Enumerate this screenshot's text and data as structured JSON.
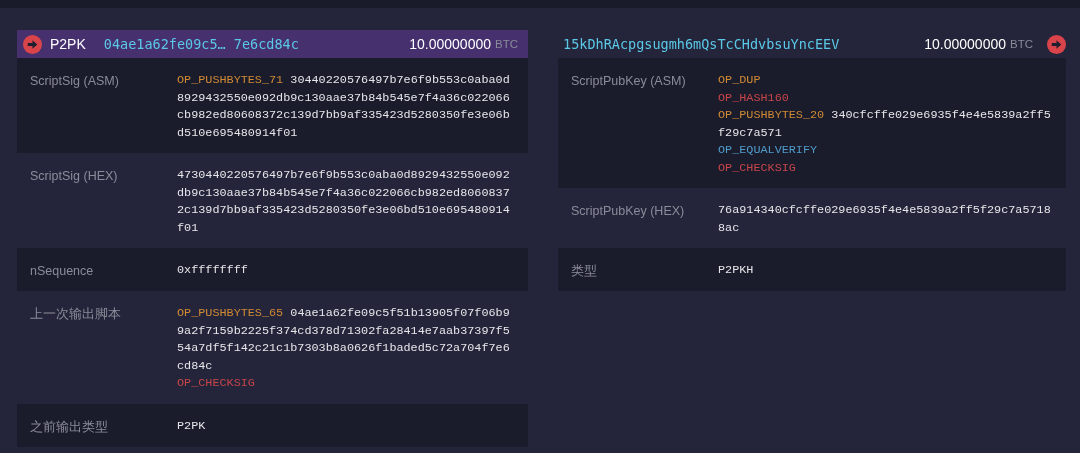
{
  "input": {
    "type": "P2PK",
    "script_preview": "04ae1a62fe09c5… 7e6cd84c",
    "amount": "10.00000000",
    "unit": "BTC",
    "rows": [
      {
        "label": "ScriptSig (ASM)",
        "lines": [
          [
            {
              "text": "OP_PUSHBYTES_71",
              "color": "#d08a34"
            },
            {
              "text": "30440220576497b7e6f9b553c0aba0d8929432550e092db9c130aae37b84b545e7f4a36c022066cb982ed80608372c139d7bb9af335423d5280350fe3e06bd510e695480914f01"
            }
          ]
        ]
      },
      {
        "label": "ScriptSig (HEX)",
        "lines": [
          [
            {
              "text": "4730440220576497b7e6f9b553c0aba0d8929432550e092db9c130aae37b84b545e7f4a36c022066cb982ed80608372c139d7bb9af335423d5280350fe3e06bd510e695480914f01"
            }
          ]
        ]
      },
      {
        "label": "nSequence",
        "lines": [
          [
            {
              "text": "0xffffffff"
            }
          ]
        ]
      },
      {
        "label": "上一次输出脚本",
        "lines": [
          [
            {
              "text": "OP_PUSHBYTES_65",
              "color": "#d08a34"
            },
            {
              "text": "04ae1a62fe09c5f51b13905f07f06b99a2f7159b2225f374cd378d71302fa28414e7aab37397f554a7df5f142c21c1b7303b8a0626f1baded5c72a704f7e6cd84c"
            }
          ],
          [
            {
              "text": "OP_CHECKSIG",
              "color": "#c8454a"
            }
          ]
        ]
      },
      {
        "label": "之前输出类型",
        "lines": [
          [
            {
              "text": "P2PK"
            }
          ]
        ]
      }
    ]
  },
  "output": {
    "address": "15kDhRAcpgsugmh6mQsTcCHdvbsuYncEEV",
    "amount": "10.00000000",
    "unit": "BTC",
    "rows": [
      {
        "label": "ScriptPubKey (ASM)",
        "lines": [
          [
            {
              "text": "OP_DUP",
              "color": "#d08a34"
            }
          ],
          [
            {
              "text": "OP_HASH160",
              "color": "#c8454a"
            }
          ],
          [
            {
              "text": "OP_PUSHBYTES_20",
              "color": "#d08a34"
            },
            {
              "text": "340cfcffe029e6935f4e4e5839a2ff5f29c7a571"
            }
          ],
          [
            {
              "text": "OP_EQUALVERIFY",
              "color": "#4f9bc9"
            }
          ],
          [
            {
              "text": "OP_CHECKSIG",
              "color": "#c8454a"
            }
          ]
        ]
      },
      {
        "label": "ScriptPubKey (HEX)",
        "lines": [
          [
            {
              "text": "76a914340cfcffe029e6935f4e4e5839a2ff5f29c7a57188ac"
            }
          ]
        ]
      },
      {
        "label": "类型",
        "lines": [
          [
            {
              "text": "P2PKH"
            }
          ]
        ]
      }
    ]
  }
}
